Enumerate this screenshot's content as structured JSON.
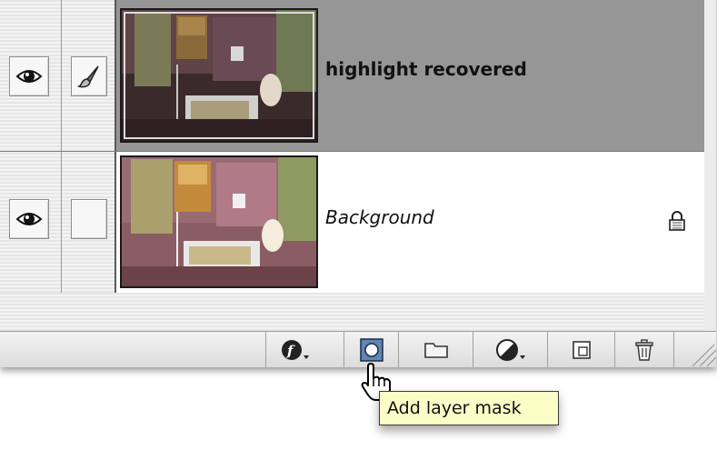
{
  "layers_panel": {
    "layers": [
      {
        "name": "highlight recovered",
        "selected": true,
        "visible": true,
        "link_icon": "brush-icon",
        "locked": false
      },
      {
        "name": "Background",
        "selected": false,
        "visible": true,
        "link_icon": "",
        "locked": true
      }
    ],
    "toolbar": {
      "buttons": [
        {
          "icon": "layer-style-icon"
        },
        {
          "icon": "add-layer-mask-icon",
          "active": true
        },
        {
          "icon": "new-group-icon"
        },
        {
          "icon": "adjustment-layer-icon"
        },
        {
          "icon": "new-layer-icon"
        },
        {
          "icon": "trash-icon"
        }
      ]
    }
  },
  "tooltip": {
    "text": "Add layer mask"
  },
  "colors": {
    "selected_row": "#969696",
    "tooltip_bg": "#fdfdc8",
    "panel_bg": "#ececec"
  }
}
